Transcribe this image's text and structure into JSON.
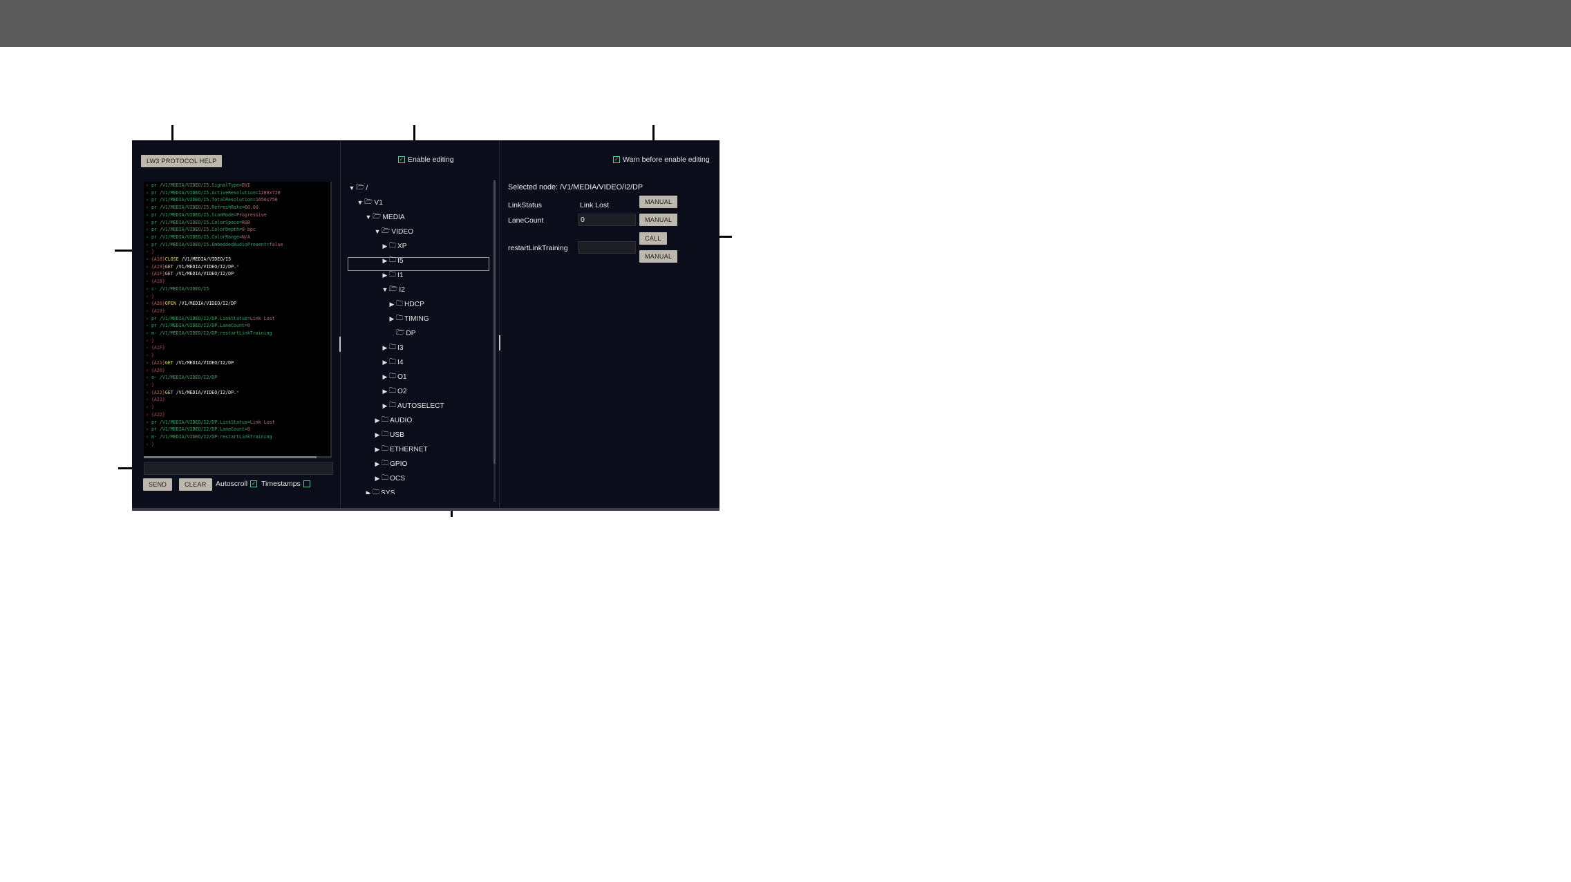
{
  "toolbar": {
    "help_button": "LW3 PROTOCOL HELP",
    "enable_editing": "Enable editing",
    "warn_editing": "Warn before enable editing"
  },
  "terminal": {
    "lines": [
      [
        [
          "c-pr",
          "› pr "
        ],
        [
          "c-pr",
          "/V1/MEDIA/VIDEO/I5.SignalType="
        ],
        [
          "c-val",
          "DVI"
        ]
      ],
      [
        [
          "c-pr",
          "› pr "
        ],
        [
          "c-pr",
          "/V1/MEDIA/VIDEO/I5.ActiveResolution="
        ],
        [
          "c-val",
          "1280x720"
        ]
      ],
      [
        [
          "c-pr",
          "› pr "
        ],
        [
          "c-pr",
          "/V1/MEDIA/VIDEO/I5.TotalResolution="
        ],
        [
          "c-val",
          "1650x750"
        ]
      ],
      [
        [
          "c-pr",
          "› pr "
        ],
        [
          "c-pr",
          "/V1/MEDIA/VIDEO/I5.RefreshRate="
        ],
        [
          "c-val",
          "60.00"
        ]
      ],
      [
        [
          "c-pr",
          "› pr "
        ],
        [
          "c-pr",
          "/V1/MEDIA/VIDEO/I5.ScanMode="
        ],
        [
          "c-val",
          "Progressive"
        ]
      ],
      [
        [
          "c-pr",
          "› pr "
        ],
        [
          "c-pr",
          "/V1/MEDIA/VIDEO/I5.ColorSpace="
        ],
        [
          "c-val",
          "RGB"
        ]
      ],
      [
        [
          "c-pr",
          "› pr "
        ],
        [
          "c-pr",
          "/V1/MEDIA/VIDEO/I5.ColorDepth="
        ],
        [
          "c-val",
          "8 bpc"
        ]
      ],
      [
        [
          "c-pr",
          "› pr "
        ],
        [
          "c-pr",
          "/V1/MEDIA/VIDEO/I5.ColorRange="
        ],
        [
          "c-val",
          "N/A"
        ]
      ],
      [
        [
          "c-pr",
          "› pr "
        ],
        [
          "c-pr",
          "/V1/MEDIA/VIDEO/I5.EmbeddedAudioPresent="
        ],
        [
          "c-val",
          "false"
        ]
      ],
      [
        [
          "c-bra",
          "‹ }"
        ]
      ],
      [
        [
          "c-id",
          "› {A18}"
        ],
        [
          "c-cmd",
          "CLOSE "
        ],
        [
          "c-path",
          "/V1/MEDIA/VIDEO/I5"
        ]
      ],
      [
        [
          "c-id",
          "› {A19}"
        ],
        [
          "c-cmd",
          "GET "
        ],
        [
          "c-path",
          "/V1/MEDIA/VIDEO/I2/DP."
        ],
        [
          "c-val",
          "*"
        ]
      ],
      [
        [
          "c-id",
          "› {A1F}"
        ],
        [
          "c-cmd",
          "GET "
        ],
        [
          "c-path",
          "/V1/MEDIA/VIDEO/I2/DP"
        ]
      ],
      [
        [
          "c-bra",
          "‹ {A18}"
        ]
      ],
      [
        [
          "c-pr",
          "‹ c- "
        ],
        [
          "c-pr",
          "/V1/MEDIA/VIDEO/I5"
        ]
      ],
      [
        [
          "c-bra",
          "‹ }"
        ]
      ],
      [
        [
          "c-id",
          "› {A20}"
        ],
        [
          "c-cmd",
          "OPEN "
        ],
        [
          "c-path",
          "/V1/MEDIA/VIDEO/I2/DP"
        ]
      ],
      [
        [
          "c-bra",
          "‹ {A19}"
        ]
      ],
      [
        [
          "c-pr",
          "‹ pr "
        ],
        [
          "c-pr",
          "/V1/MEDIA/VIDEO/I2/DP.LinkStatus="
        ],
        [
          "c-val",
          "Link Lost"
        ]
      ],
      [
        [
          "c-pr",
          "‹ pr "
        ],
        [
          "c-pr",
          "/V1/MEDIA/VIDEO/I2/DP.LaneCount="
        ],
        [
          "c-val",
          "0"
        ]
      ],
      [
        [
          "c-pr",
          "‹ m- "
        ],
        [
          "c-pr",
          "/V1/MEDIA/VIDEO/I2/DP:restartLinkTraining"
        ]
      ],
      [
        [
          "c-bra",
          "‹ }"
        ]
      ],
      [
        [
          "c-bra",
          "‹ {A1F}"
        ]
      ],
      [
        [
          "c-bra",
          "‹ }"
        ]
      ],
      [
        [
          "c-id",
          "› {A21}"
        ],
        [
          "c-cmd",
          "GET "
        ],
        [
          "c-path",
          "/V1/MEDIA/VIDEO/I2/DP"
        ]
      ],
      [
        [
          "c-bra",
          "‹ {A20}"
        ]
      ],
      [
        [
          "c-pr",
          "‹ o- "
        ],
        [
          "c-pr",
          "/V1/MEDIA/VIDEO/I2/DP"
        ]
      ],
      [
        [
          "c-bra",
          "‹ }"
        ]
      ],
      [
        [
          "c-id",
          "› {A22}"
        ],
        [
          "c-cmd",
          "GET "
        ],
        [
          "c-path",
          "/V1/MEDIA/VIDEO/I2/DP."
        ],
        [
          "c-val",
          "*"
        ]
      ],
      [
        [
          "c-bra",
          "‹ {A21}"
        ]
      ],
      [
        [
          "c-bra",
          "‹ }"
        ]
      ],
      [
        [
          "c-bra",
          "‹ {A22}"
        ]
      ],
      [
        [
          "c-pr",
          "‹ pr "
        ],
        [
          "c-pr",
          "/V1/MEDIA/VIDEO/I2/DP.LinkStatus="
        ],
        [
          "c-val",
          "Link Lost"
        ]
      ],
      [
        [
          "c-pr",
          "‹ pr "
        ],
        [
          "c-pr",
          "/V1/MEDIA/VIDEO/I2/DP.LaneCount="
        ],
        [
          "c-val",
          "0"
        ]
      ],
      [
        [
          "c-pr",
          "‹ m- "
        ],
        [
          "c-pr",
          "/V1/MEDIA/VIDEO/I2/DP:restartLinkTraining"
        ]
      ],
      [
        [
          "c-bra",
          "‹ }"
        ]
      ]
    ]
  },
  "bottom": {
    "send": "SEND",
    "clear": "CLEAR",
    "autoscroll": "Autoscroll",
    "timestamps": "Timestamps"
  },
  "tree": [
    {
      "label": "/",
      "depth": 0,
      "arrow": "down",
      "open": true
    },
    {
      "label": "V1",
      "depth": 1,
      "arrow": "down",
      "open": true
    },
    {
      "label": "MEDIA",
      "depth": 2,
      "arrow": "down",
      "open": true
    },
    {
      "label": "VIDEO",
      "depth": 3,
      "arrow": "down",
      "open": true
    },
    {
      "label": "XP",
      "depth": 4,
      "arrow": "right",
      "open": false
    },
    {
      "label": "I5",
      "depth": 4,
      "arrow": "right",
      "open": false
    },
    {
      "label": "I1",
      "depth": 4,
      "arrow": "right",
      "open": false
    },
    {
      "label": "I2",
      "depth": 4,
      "arrow": "down",
      "open": true
    },
    {
      "label": "HDCP",
      "depth": 5,
      "arrow": "right",
      "open": false
    },
    {
      "label": "TIMING",
      "depth": 5,
      "arrow": "right",
      "open": false
    },
    {
      "label": "DP",
      "depth": 5,
      "arrow": "none",
      "open": true
    },
    {
      "label": "I3",
      "depth": 4,
      "arrow": "right",
      "open": false
    },
    {
      "label": "I4",
      "depth": 4,
      "arrow": "right",
      "open": false
    },
    {
      "label": "O1",
      "depth": 4,
      "arrow": "right",
      "open": false
    },
    {
      "label": "O2",
      "depth": 4,
      "arrow": "right",
      "open": false
    },
    {
      "label": "AUTOSELECT",
      "depth": 4,
      "arrow": "right",
      "open": false
    },
    {
      "label": "AUDIO",
      "depth": 3,
      "arrow": "right",
      "open": false
    },
    {
      "label": "USB",
      "depth": 3,
      "arrow": "right",
      "open": false
    },
    {
      "label": "ETHERNET",
      "depth": 3,
      "arrow": "right",
      "open": false
    },
    {
      "label": "GPIO",
      "depth": 3,
      "arrow": "right",
      "open": false
    },
    {
      "label": "OCS",
      "depth": 3,
      "arrow": "right",
      "open": false
    },
    {
      "label": "SYS",
      "depth": 2,
      "arrow": "right",
      "open": false
    }
  ],
  "props": {
    "selected_node": "Selected node: /V1/MEDIA/VIDEO/I2/DP",
    "link_status_label": "LinkStatus",
    "link_status_value": "Link Lost",
    "lane_count_label": "LaneCount",
    "lane_count_value": "0",
    "restart_label": "restartLinkTraining",
    "manual": "MANUAL",
    "call": "CALL"
  },
  "colors": {
    "app_bg": "#0b0d1a",
    "button_bg": "#bcb8ad",
    "check_accent": "#5fd08a",
    "topbar": "#5b5b5b"
  }
}
